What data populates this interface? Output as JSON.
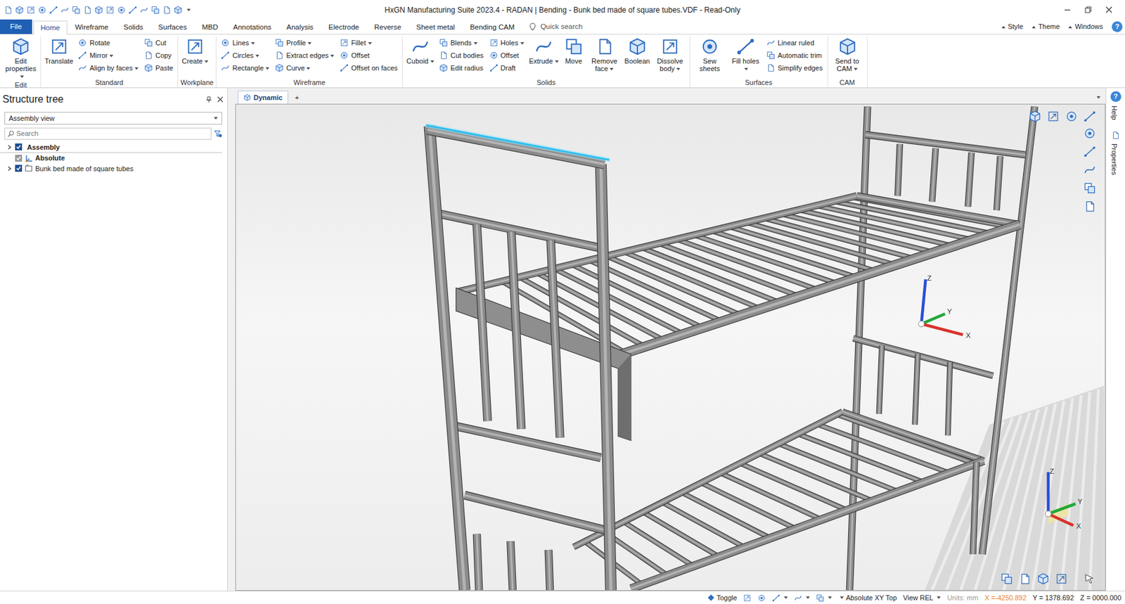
{
  "window": {
    "title": "HxGN Manufacturing Suite 2023.4 - RADAN | Bending - Bunk bed made of square tubes.VDF - Read-Only"
  },
  "ribbon": {
    "file_button": {
      "label": "File"
    },
    "tabs": [
      {
        "label": "Home",
        "selected": true
      },
      {
        "label": "Wireframe",
        "selected": false
      },
      {
        "label": "Solids",
        "selected": false
      },
      {
        "label": "Surfaces",
        "selected": false
      },
      {
        "label": "MBD",
        "selected": false
      },
      {
        "label": "Annotations",
        "selected": false
      },
      {
        "label": "Analysis",
        "selected": false
      },
      {
        "label": "Electrode",
        "selected": false
      },
      {
        "label": "Reverse",
        "selected": false
      },
      {
        "label": "Sheet metal",
        "selected": false
      },
      {
        "label": "Bending CAM",
        "selected": false
      }
    ],
    "quick_search": {
      "placeholder": "Quick search"
    },
    "menus": [
      {
        "label": "Style"
      },
      {
        "label": "Theme"
      },
      {
        "label": "Windows"
      }
    ],
    "help_button": "?",
    "groups": [
      {
        "label": "Edit",
        "items": [
          {
            "label": "Edit properties",
            "kind": "large",
            "dropdown": true
          }
        ]
      },
      {
        "label": "Standard",
        "items": [
          {
            "label": "Translate",
            "kind": "large",
            "dropdown": false
          },
          {
            "label": "Rotate",
            "kind": "small",
            "dropdown": false
          },
          {
            "label": "Mirror",
            "kind": "small",
            "dropdown": true
          },
          {
            "label": "Align by faces",
            "kind": "small",
            "dropdown": true
          },
          {
            "label": "Cut",
            "kind": "small",
            "dropdown": false
          },
          {
            "label": "Copy",
            "kind": "small",
            "dropdown": false
          },
          {
            "label": "Paste",
            "kind": "small",
            "dropdown": false
          }
        ]
      },
      {
        "label": "Workplane",
        "items": [
          {
            "label": "Create",
            "kind": "large",
            "dropdown": true
          }
        ]
      },
      {
        "label": "Wireframe",
        "items": [
          {
            "label": "Lines",
            "kind": "small",
            "dropdown": true
          },
          {
            "label": "Circles",
            "kind": "small",
            "dropdown": true
          },
          {
            "label": "Rectangle",
            "kind": "small",
            "dropdown": true
          },
          {
            "label": "Profile",
            "kind": "small",
            "dropdown": true
          },
          {
            "label": "Extract edges",
            "kind": "small",
            "dropdown": true
          },
          {
            "label": "Curve",
            "kind": "small",
            "dropdown": true
          },
          {
            "label": "Fillet",
            "kind": "small",
            "dropdown": true
          },
          {
            "label": "Offset",
            "kind": "small",
            "dropdown": false
          },
          {
            "label": "Offset on faces",
            "kind": "small",
            "dropdown": false
          }
        ]
      },
      {
        "label": "Solids",
        "items": [
          {
            "label": "Cuboid",
            "kind": "large",
            "dropdown": true
          },
          {
            "label": "Blends",
            "kind": "small",
            "dropdown": true
          },
          {
            "label": "Cut bodies",
            "kind": "small",
            "dropdown": false
          },
          {
            "label": "Edit radius",
            "kind": "small",
            "dropdown": false
          },
          {
            "label": "Holes",
            "kind": "small",
            "dropdown": true
          },
          {
            "label": "Offset",
            "kind": "small",
            "dropdown": false
          },
          {
            "label": "Draft",
            "kind": "small",
            "dropdown": false
          },
          {
            "label": "Extrude",
            "kind": "large",
            "dropdown": true
          },
          {
            "label": "Move",
            "kind": "large",
            "dropdown": false
          },
          {
            "label": "Remove face",
            "kind": "large",
            "dropdown": true
          },
          {
            "label": "Boolean",
            "kind": "large",
            "dropdown": false
          },
          {
            "label": "Dissolve body",
            "kind": "large",
            "dropdown": true
          }
        ]
      },
      {
        "label": "Surfaces",
        "items": [
          {
            "label": "Sew sheets",
            "kind": "large",
            "dropdown": false
          },
          {
            "label": "Fill holes",
            "kind": "large",
            "dropdown": true
          },
          {
            "label": "Linear ruled",
            "kind": "small",
            "dropdown": false
          },
          {
            "label": "Automatic trim",
            "kind": "small",
            "dropdown": false
          },
          {
            "label": "Simplify edges",
            "kind": "small",
            "dropdown": false
          }
        ]
      },
      {
        "label": "CAM",
        "items": [
          {
            "label": "Send to CAM",
            "kind": "large",
            "dropdown": true
          }
        ]
      }
    ]
  },
  "structure_tree": {
    "title": "Structure tree",
    "view": "Assembly view",
    "search": {
      "placeholder": "Search"
    },
    "items": [
      {
        "label": "Assembly",
        "kind": "root",
        "checked": true,
        "disabled": false,
        "has_children": true,
        "expanded": false,
        "bold": true
      },
      {
        "label": "Absolute",
        "kind": "frame",
        "checked": true,
        "disabled": true,
        "has_children": false,
        "expanded": false,
        "bold": true
      },
      {
        "label": "Bunk bed made of square tubes",
        "kind": "part",
        "checked": true,
        "disabled": false,
        "has_children": true,
        "expanded": false,
        "bold": false
      }
    ]
  },
  "viewport": {
    "tabs": [
      {
        "label": "Dynamic",
        "selected": true
      },
      {
        "label": "+",
        "selected": false
      }
    ],
    "triads": [
      {
        "x": "X",
        "y": "Y",
        "z": "Z"
      },
      {
        "x": "X",
        "y": "Y",
        "z": "Z"
      }
    ]
  },
  "side_panel": {
    "help_glyph": "?",
    "tabs": [
      {
        "label": "Help"
      },
      {
        "label": "Properties"
      }
    ]
  },
  "status_bar": {
    "toggle": "Toggle",
    "workplane": "Absolute XY Top",
    "view": "View REL",
    "units": {
      "label": "Units: mm",
      "disabled": true
    },
    "coords": [
      {
        "label": "X =-4250.892",
        "color": "#e8821e"
      },
      {
        "label": "Y = 1378.692",
        "color": "#222222"
      },
      {
        "label": "Z = 0000.000",
        "color": "#222222"
      }
    ]
  }
}
